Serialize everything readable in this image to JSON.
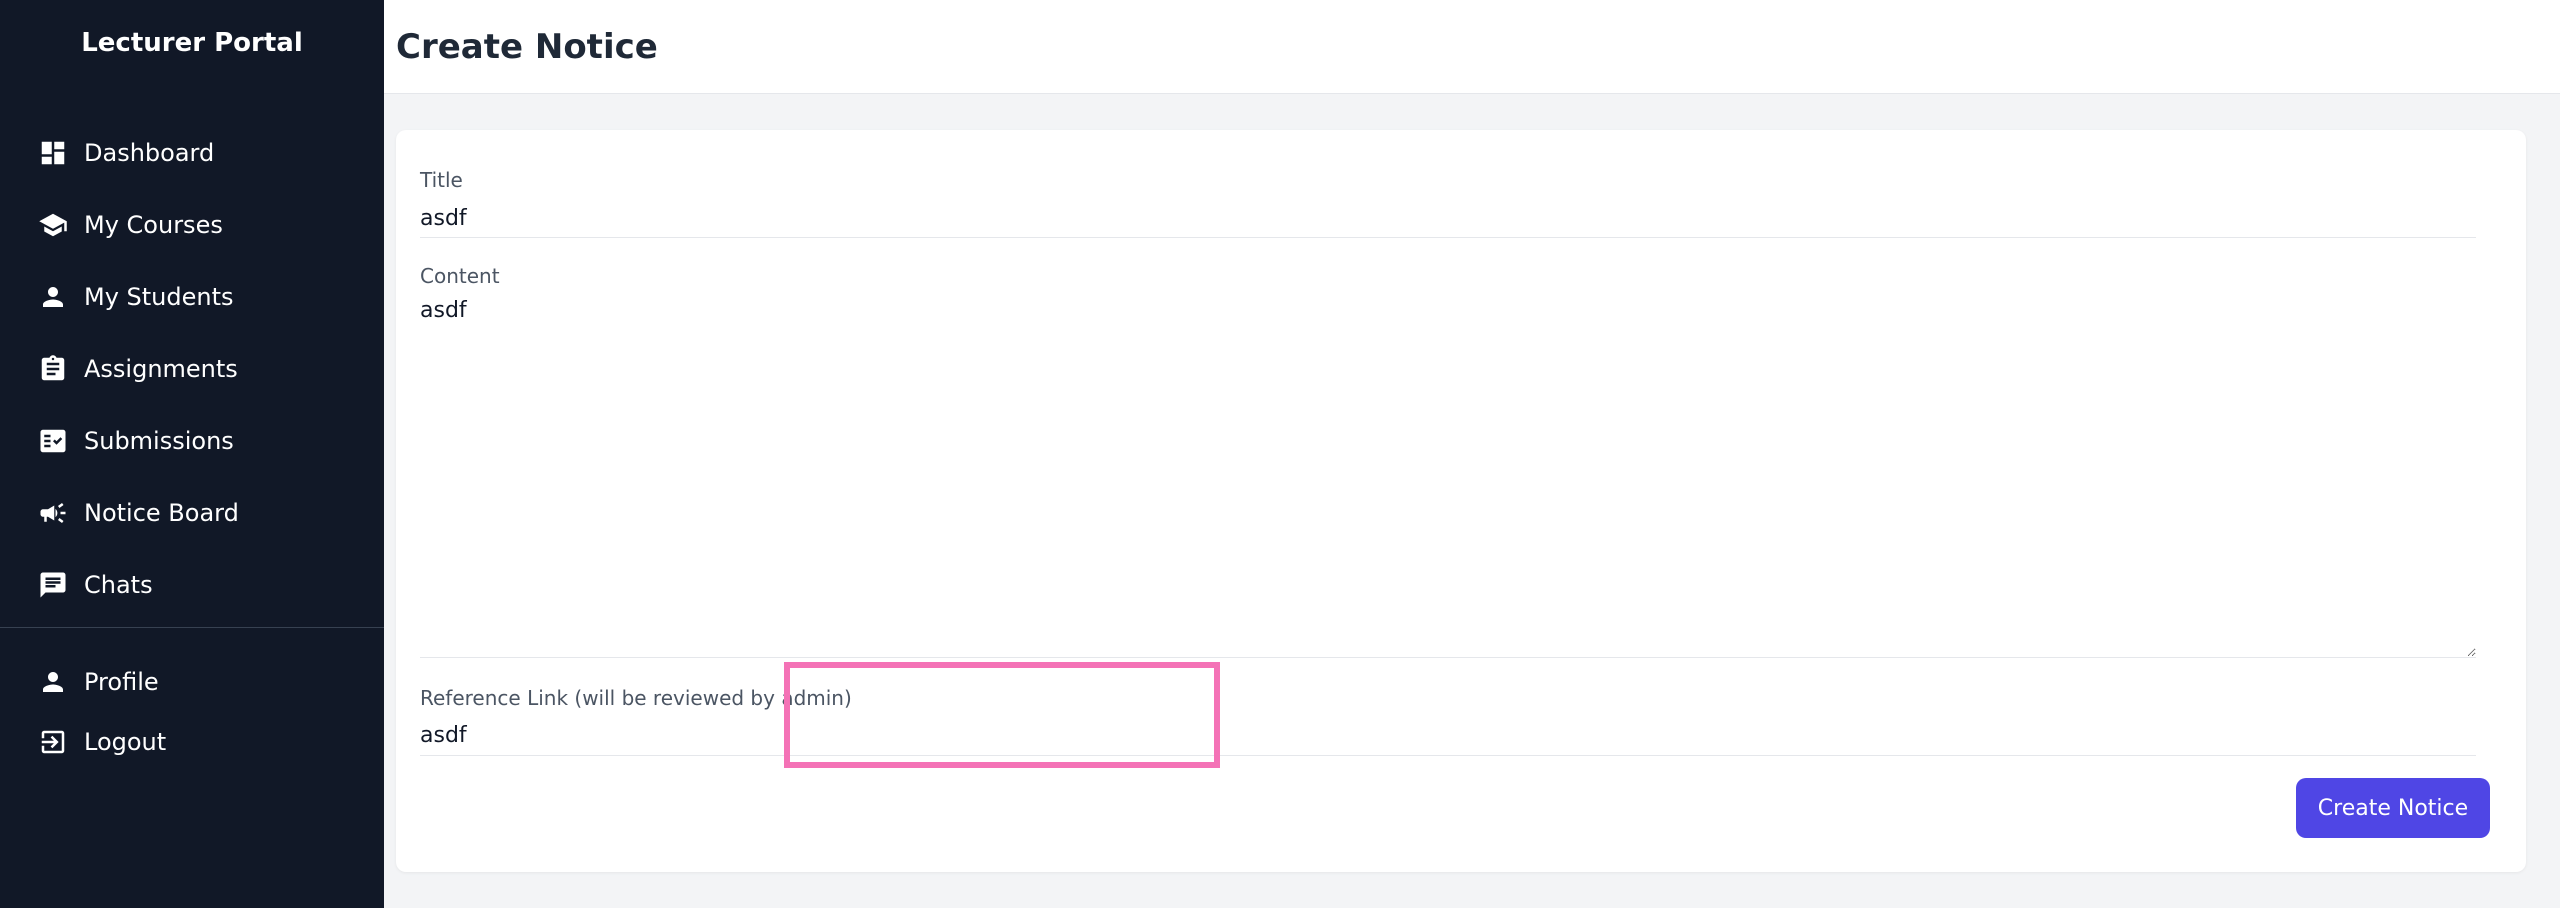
{
  "sidebar": {
    "brand": "Lecturer Portal",
    "items": [
      {
        "label": "Dashboard",
        "icon": "dashboard-icon"
      },
      {
        "label": "My Courses",
        "icon": "graduation-cap-icon"
      },
      {
        "label": "My Students",
        "icon": "person-icon"
      },
      {
        "label": "Assignments",
        "icon": "clipboard-icon"
      },
      {
        "label": "Submissions",
        "icon": "checklist-icon"
      },
      {
        "label": "Notice Board",
        "icon": "megaphone-icon"
      },
      {
        "label": "Chats",
        "icon": "chat-bubble-icon"
      }
    ],
    "bottom_items": [
      {
        "label": "Profile",
        "icon": "person-icon"
      },
      {
        "label": "Logout",
        "icon": "logout-icon"
      }
    ]
  },
  "header": {
    "title": "Create Notice"
  },
  "form": {
    "title_label": "Title",
    "title_value": "asdf",
    "content_label": "Content",
    "content_value": "asdf",
    "reference_label": "Reference Link (will be reviewed by admin)",
    "reference_value": "asdf",
    "submit_label": "Create Notice"
  },
  "colors": {
    "sidebar_bg": "#111827",
    "accent": "#4f46e5",
    "highlight": "#f472b6"
  }
}
